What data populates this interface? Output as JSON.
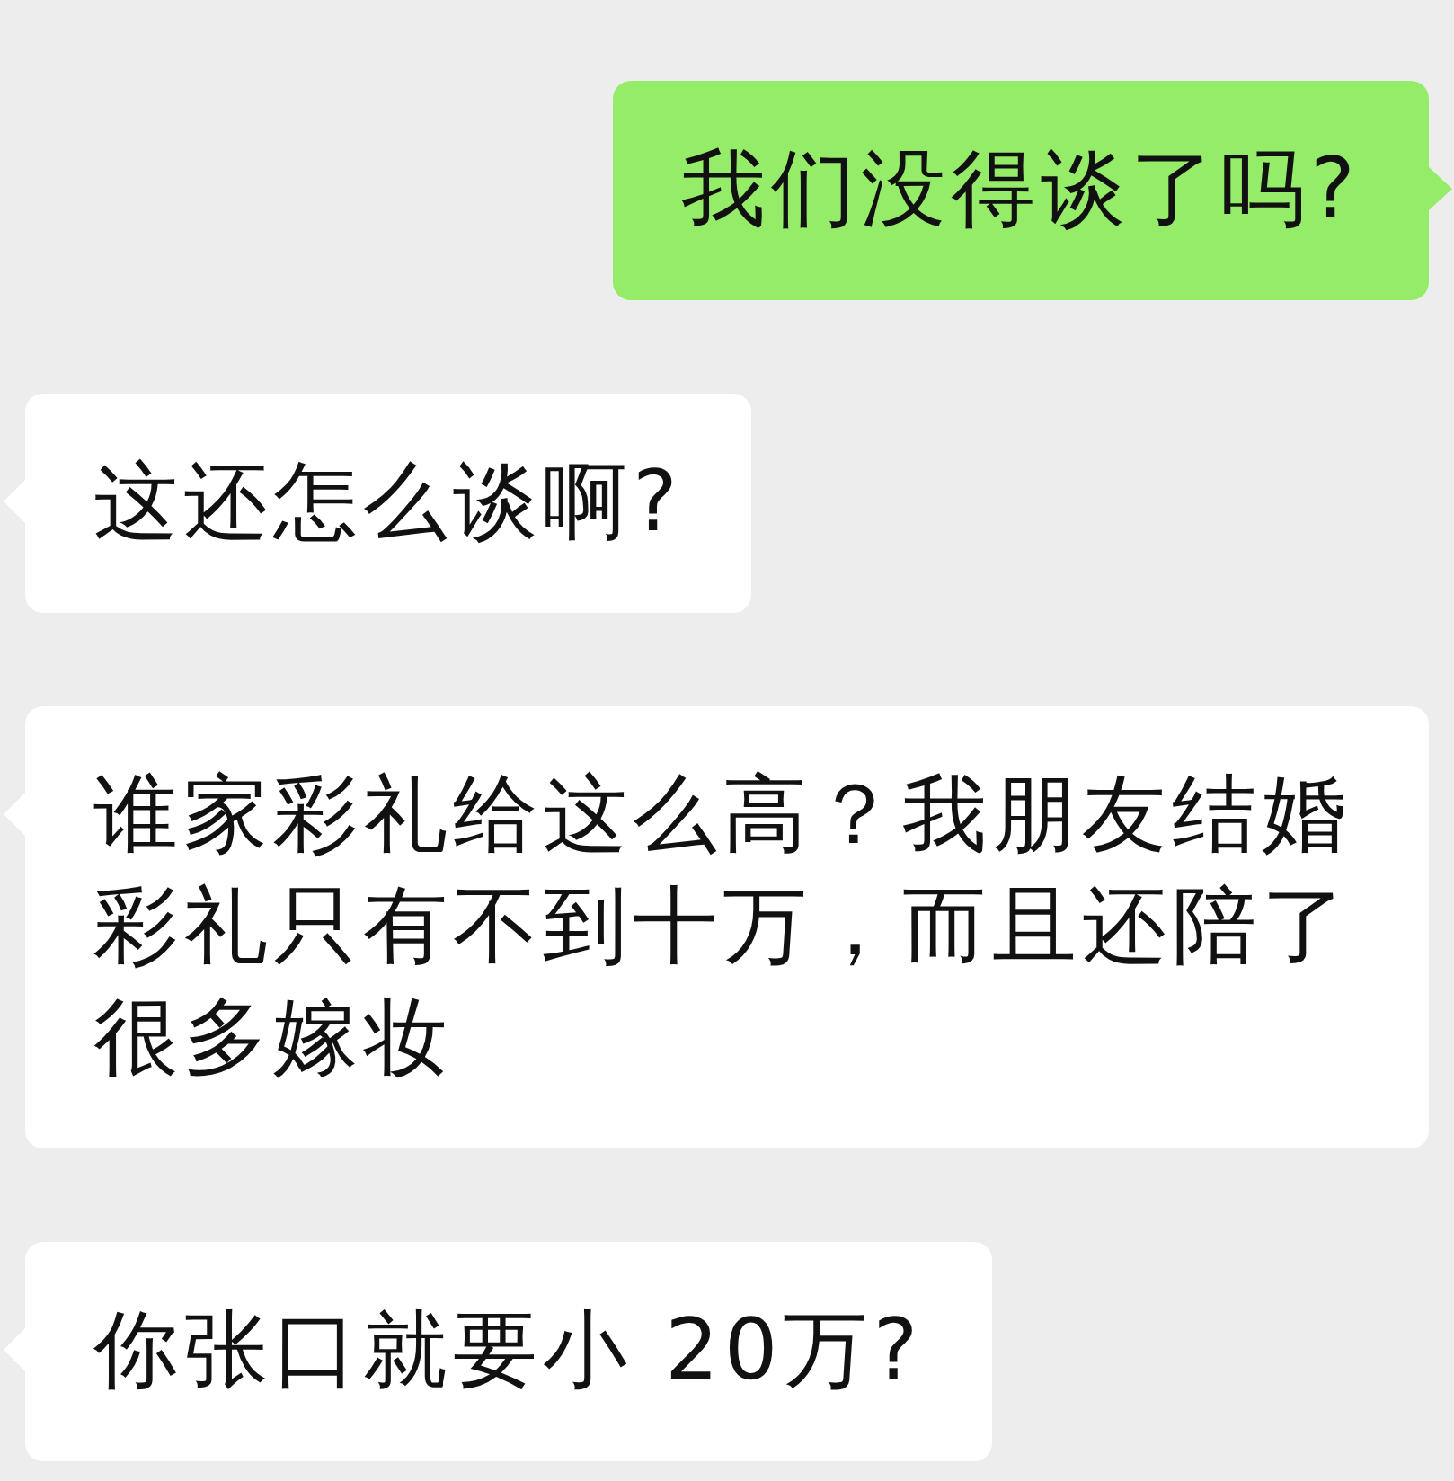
{
  "messages": [
    {
      "kind": "sent",
      "text": "我们没得谈了吗?"
    },
    {
      "kind": "received",
      "text": "这还怎么谈啊?"
    },
    {
      "kind": "received",
      "text": "谁家彩礼给这么高？我朋友结婚彩礼只有不到十万，而且还陪了很多嫁妆"
    },
    {
      "kind": "received",
      "text": "你张口就要小 20万?"
    }
  ]
}
